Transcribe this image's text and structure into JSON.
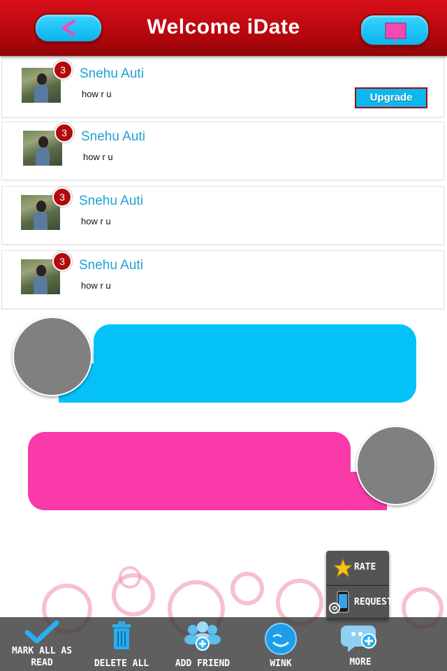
{
  "header": {
    "title": "Welcome iDate"
  },
  "conversations": [
    {
      "name": "Snehu Auti",
      "message": "how r u",
      "unread": "3"
    },
    {
      "name": "Snehu Auti",
      "message": "how r u",
      "unread": "3"
    },
    {
      "name": "Snehu Auti",
      "message": "how r u",
      "unread": "3"
    },
    {
      "name": "Snehu Auti",
      "message": "how r u",
      "unread": "3"
    }
  ],
  "upgrade_label": "Upgrade",
  "popup": {
    "rate": "RATE",
    "request": "REQUEST"
  },
  "tabbar": {
    "mark_all_line1": "MARK ALL AS",
    "mark_all_line2": "READ",
    "delete_all": "DELETE ALL",
    "add_friend": "ADD FRIEND",
    "wink": "WINK",
    "more": "MORE"
  },
  "colors": {
    "header": "#c0080f",
    "accent_blue": "#04c2f8",
    "accent_pink": "#f93aa8",
    "name_text": "#1ea2d2"
  }
}
